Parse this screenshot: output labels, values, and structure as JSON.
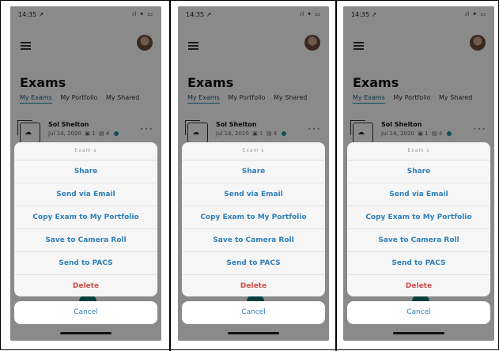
{
  "status": {
    "time": "14:35 ↗",
    "icons": "ıl ✦ ▭"
  },
  "screen": {
    "title": "Exams",
    "tabs": [
      "My Exams",
      "My Portfolio",
      "My Shared"
    ],
    "exam": {
      "name": "Sol Shelton",
      "date": "Jul 14, 2020",
      "series": "1",
      "images": "4"
    }
  },
  "sheet": {
    "header": "Exam s",
    "actions": [
      "Share",
      "Send via Email",
      "Copy Exam to My Portfolio",
      "Save to Camera Roll",
      "Send to PACS"
    ],
    "delete": "Delete",
    "cancel": "Cancel"
  },
  "colors": {
    "accent": "#2f7fb9",
    "danger": "#d44a4a",
    "tab_active": "#1f8fa8"
  },
  "icons": {
    "menu": "hamburger-icon",
    "exam": "study-stack-icon",
    "more": "ellipsis-icon"
  }
}
